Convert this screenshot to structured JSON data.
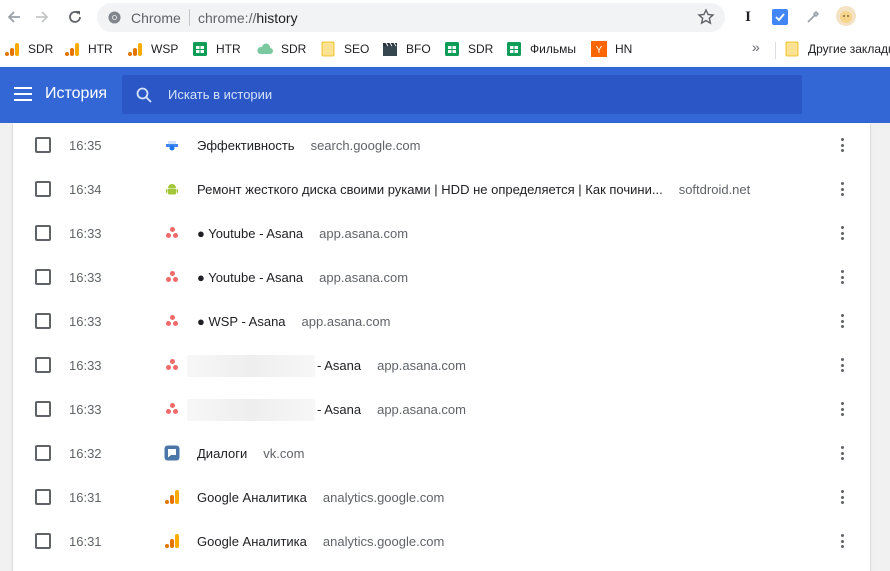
{
  "toolbar": {
    "site_label": "Chrome",
    "url_scheme": "chrome://",
    "url_path": "history"
  },
  "bookmarks": [
    {
      "label": "SDR",
      "icon": "analytics-icon"
    },
    {
      "label": "HTR",
      "icon": "analytics-icon"
    },
    {
      "label": "WSP",
      "icon": "analytics-icon"
    },
    {
      "label": "HTR",
      "icon": "sheets-icon"
    },
    {
      "label": "SDR",
      "icon": "cloud-icon"
    },
    {
      "label": "SEO",
      "icon": "folder-icon"
    },
    {
      "label": "BFO",
      "icon": "clapper-icon"
    },
    {
      "label": "SDR",
      "icon": "sheets-icon"
    },
    {
      "label": "Фильмы",
      "icon": "sheets-icon"
    },
    {
      "label": "HN",
      "icon": "y-icon"
    }
  ],
  "bookmarks_more": "»",
  "other_bookmarks": "Другие закладк",
  "header": {
    "title": "История",
    "search_placeholder": "Искать в истории"
  },
  "history": [
    {
      "time": "16:35",
      "title": "Эффективность",
      "domain": "search.google.com",
      "icon": "search-console-icon"
    },
    {
      "time": "16:34",
      "title": "Ремонт жесткого диска своими руками | HDD не определяется | Как почини...",
      "domain": "softdroid.net",
      "icon": "android-icon"
    },
    {
      "time": "16:33",
      "title": "● Youtube - Asana",
      "domain": "app.asana.com",
      "icon": "asana-icon"
    },
    {
      "time": "16:33",
      "title": "● Youtube - Asana",
      "domain": "app.asana.com",
      "icon": "asana-icon"
    },
    {
      "time": "16:33",
      "title": "● WSP - Asana",
      "domain": "app.asana.com",
      "icon": "asana-icon"
    },
    {
      "time": "16:33",
      "title": "- Asana",
      "domain": "app.asana.com",
      "icon": "asana-icon",
      "redacted": true
    },
    {
      "time": "16:33",
      "title": "- Asana",
      "domain": "app.asana.com",
      "icon": "asana-icon",
      "redacted": true
    },
    {
      "time": "16:32",
      "title": "Диалоги",
      "domain": "vk.com",
      "icon": "vk-dialogs-icon"
    },
    {
      "time": "16:31",
      "title": "Google Аналитика",
      "domain": "analytics.google.com",
      "icon": "analytics-icon"
    },
    {
      "time": "16:31",
      "title": "Google Аналитика",
      "domain": "analytics.google.com",
      "icon": "analytics-icon"
    }
  ],
  "colors": {
    "header_bg": "#3367d6",
    "search_bg": "#2a56c6",
    "asana": "#f06a6a",
    "analytics_orange": "#f9ab00",
    "sheets_green": "#0f9d58",
    "android_green": "#a4c639"
  }
}
